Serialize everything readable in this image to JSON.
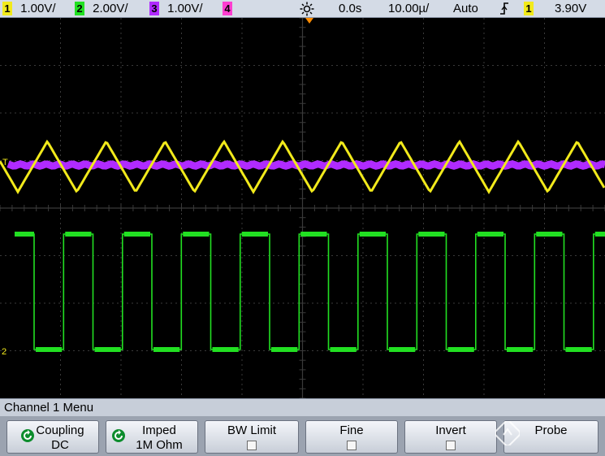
{
  "status_bar": {
    "ch1": {
      "number": "1",
      "scale": "1.00V/",
      "color": "#f2ea1b"
    },
    "ch2": {
      "number": "2",
      "scale": "2.00V/",
      "color": "#22e022"
    },
    "ch3": {
      "number": "3",
      "scale": "1.00V/",
      "color": "#b02bff"
    },
    "ch4": {
      "number": "4",
      "color": "#ff3dd0"
    },
    "trigger_position": "0.0s",
    "time_scale": "10.00µ/",
    "trigger_mode": "Auto",
    "trigger_source": "1",
    "trigger_level": "3.90V",
    "icons": [
      "acquire-sun-icon",
      "trigger-edge-icon"
    ]
  },
  "screen": {
    "background": "#000000",
    "grid_color": "#3a3a3a",
    "marker_ch1": "T",
    "marker_ch2": "2"
  },
  "menu": {
    "title": "Channel 1  Menu",
    "softkeys": [
      {
        "label": "Coupling",
        "value": "DC"
      },
      {
        "label": "Imped",
        "value": "1M Ohm"
      },
      {
        "label": "BW Limit",
        "checked": false
      },
      {
        "label": "Fine",
        "checked": false
      },
      {
        "label": "Invert",
        "checked": false
      },
      {
        "label": "Probe"
      }
    ]
  }
}
